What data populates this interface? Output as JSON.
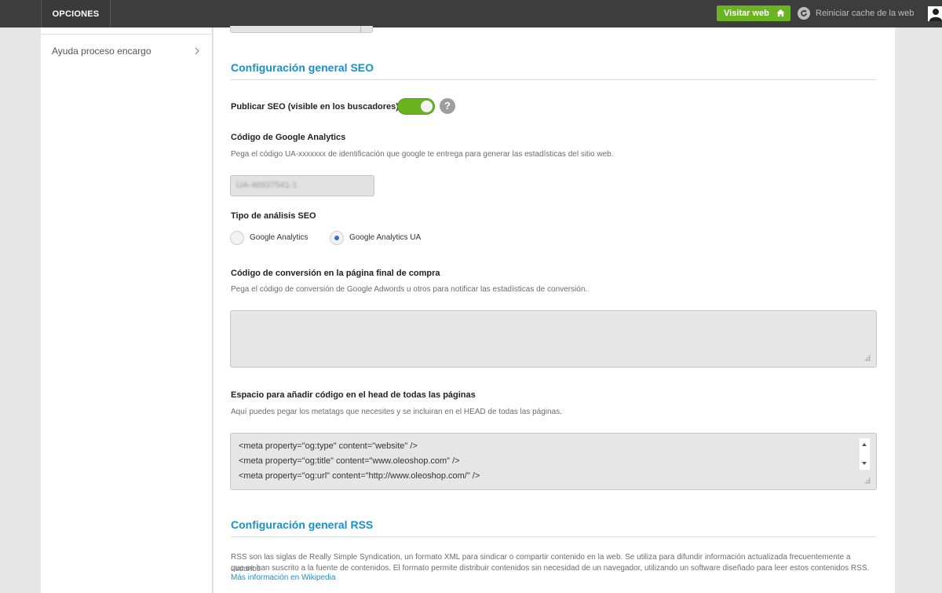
{
  "topbar": {
    "options_label": "OPCIONES",
    "visit_label": "Visitar web",
    "reset_cache_label": "Reiniciar cache de la web"
  },
  "sidebar": {
    "items": [
      {
        "label": "Ayuda proceso encargo"
      }
    ]
  },
  "seo": {
    "title": "Configuración general SEO",
    "publish_label": "Publicar SEO (visible en los buscadores)",
    "publish_enabled": true,
    "help_icon_text": "?",
    "analytics_label": "Código de Google Analytics",
    "analytics_help": "Pega el código UA-xxxxxxx de identificación que google te entrega para generar las estadísticas del sitio web.",
    "analytics_value": "UA-46937541-1",
    "analysis_type_label": "Tipo de análisis SEO",
    "analysis_options": [
      {
        "label": "Google Analytics",
        "checked": false
      },
      {
        "label": "Google Analytics UA",
        "checked": true
      }
    ],
    "conversion_label": "Código de conversión en la página final de compra",
    "conversion_help": "Pega el código de conversión de Google Adwords u otros para notificar las estadísticas de conversión.",
    "conversion_value": "",
    "head_label": "Espacio para añadir código en el head de todas las páginas",
    "head_help": "Aquí puedes pegar los metatags que necesites y se incluiran en el HEAD de todas las páginas.",
    "head_lines": [
      "<meta property=\"og:type\" content=\"website\" />",
      "<meta property=\"og:title\" content=\"www.oleoshop.com\" />",
      "<meta property=\"og:url\" content=\"http://www.oleoshop.com/\" />"
    ]
  },
  "rss": {
    "title": "Configuración general RSS",
    "description_line1": "RSS son las siglas de Really Simple Syndication, un formato XML para sindicar o compartir contenido en la web. Se utiliza para difundir información actualizada frecuentemente a usuarios",
    "description_line2": "que se han suscrito a la fuente de contenidos. El formato permite distribuir contenidos sin necesidad de un navegador, utilizando un software diseñado para leer estos contenidos RSS.",
    "more_link": "Más información en Wikipedia"
  },
  "colors": {
    "accent": "#1c8fc6",
    "green": "#6ab321",
    "topbar": "#3d3d3d"
  }
}
